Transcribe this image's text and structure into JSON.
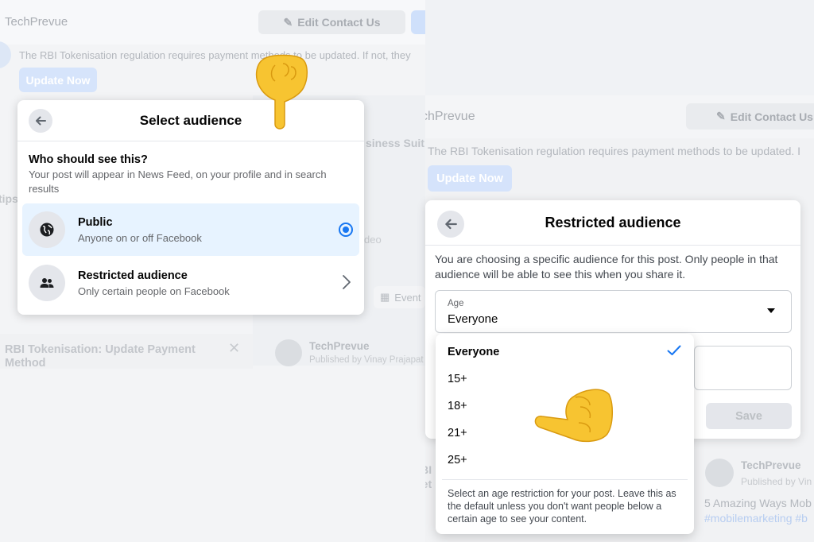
{
  "background_left": {
    "brand": "TechPrevue",
    "edit_button": "Edit Contact Us",
    "notice": "The RBI Tokenisation regulation requires payment methods to be updated. If not, they",
    "update_button": "Update Now",
    "tips_fragment": "tips",
    "card_title": "RBI Tokenisation: Update Payment Method",
    "business_fragment": "siness Suit",
    "video_fragment": "deo",
    "event_chip": "Event",
    "post_author": "TechPrevue",
    "post_published": "Published by Vinay Prajapat"
  },
  "background_right": {
    "brand": "chPrevue",
    "edit_button": "Edit Contact Us",
    "notice": "The RBI Tokenisation regulation requires payment methods to be updated. I",
    "update_button": "Update Now",
    "rbi_fragment_1": "RBI",
    "rbi_fragment_2": "Met",
    "post_author": "TechPrevue",
    "post_published": "Published by Vin",
    "post_text": "5 Amazing Ways Mob",
    "post_hashtags": "#mobilemarketing #b"
  },
  "select_audience": {
    "title": "Select audience",
    "question": "Who should see this?",
    "description": "Your post will appear in News Feed, on your profile and in search results",
    "options": [
      {
        "label": "Public",
        "sub": "Anyone on or off Facebook",
        "icon": "globe-icon",
        "selected": true
      },
      {
        "label": "Restricted audience",
        "sub": "Only certain people on Facebook",
        "icon": "people-icon",
        "selected": false
      }
    ]
  },
  "restricted_audience": {
    "title": "Restricted audience",
    "description": "You are choosing a specific audience for this post. Only people in that audience will be able to see this when you share it.",
    "age_caption": "Age",
    "age_value": "Everyone",
    "save_button": "Save"
  },
  "age_dropdown": {
    "options": [
      "Everyone",
      "15+",
      "18+",
      "21+",
      "25+"
    ],
    "selected": "Everyone",
    "help_text": "Select an age restriction for your post. Leave this as the default unless you don't want people below a certain age to see your content."
  },
  "colors": {
    "accent": "#1877f2",
    "selected_bg": "#e7f3ff",
    "hand": "#f7c431"
  }
}
